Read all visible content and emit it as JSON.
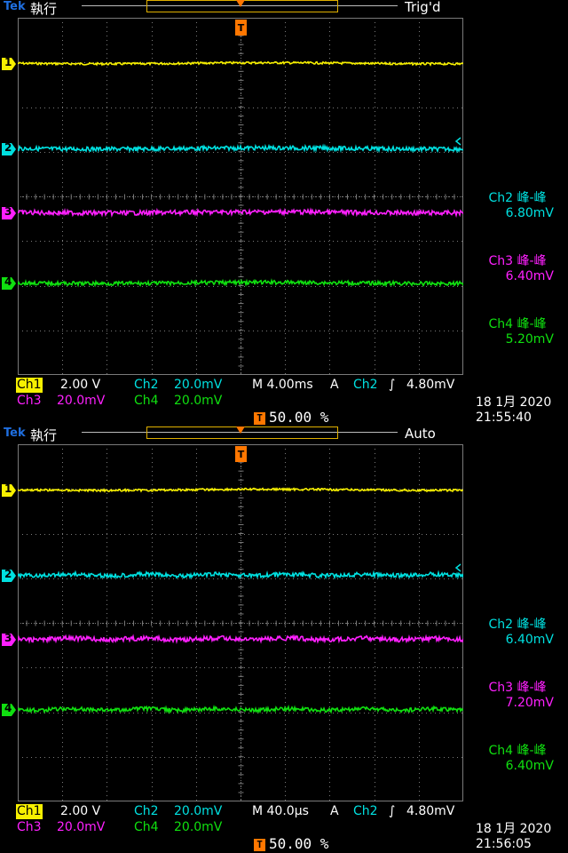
{
  "colors": {
    "ch1": "#f7f000",
    "ch2": "#00e0e0",
    "ch3": "#ff20ff",
    "ch4": "#10e010",
    "grid": "#7a7a7a",
    "trigger": "#ff7700",
    "brand": "#1f6fe0"
  },
  "icons": {
    "trigger_position": "trigger-position-icon",
    "ch2_trigger_level": "trigger-level-arrow-icon",
    "rising_edge": "rising-edge-icon",
    "coupling": "bandwidth-limit-icon"
  },
  "screens": [
    {
      "brand": "Tek",
      "mode": "執行",
      "trig_state": "Trig'd",
      "channels": [
        {
          "id": "1",
          "scale": "2.00 V",
          "level": 0.1275
        },
        {
          "id": "2",
          "scale": "20.0mV",
          "level": 0.366
        },
        {
          "id": "3",
          "scale": "20.0mV",
          "level": 0.545
        },
        {
          "id": "4",
          "scale": "20.0mV",
          "level": 0.7425
        }
      ],
      "measurements": [
        {
          "label": "Ch2 峰-峰",
          "value": "6.80mV"
        },
        {
          "label": "Ch3 峰-峰",
          "value": "6.40mV"
        },
        {
          "label": "Ch4 峰-峰",
          "value": "5.20mV"
        }
      ],
      "ch1_label": "Ch1",
      "ch1_scale": "2.00 V",
      "ch2_label": "Ch2",
      "ch2_scale": "20.0mV",
      "ch3_label": "Ch3",
      "ch3_scale": "20.0mV",
      "ch4_label": "Ch4",
      "ch4_scale": "20.0mV",
      "timebase": "M 4.00ms",
      "trig_mode": "A",
      "trig_source": "Ch2",
      "trig_slope": "∫",
      "trig_level": "4.80mV",
      "trig_position": "50.00 %",
      "date": "18 1月  2020",
      "time": "21:55:40"
    },
    {
      "brand": "Tek",
      "mode": "執行",
      "trig_state": "Auto",
      "channels": [
        {
          "id": "1",
          "scale": "2.00 V",
          "level": 0.1275
        },
        {
          "id": "2",
          "scale": "20.0mV",
          "level": 0.366
        },
        {
          "id": "3",
          "scale": "20.0mV",
          "level": 0.545
        },
        {
          "id": "4",
          "scale": "20.0mV",
          "level": 0.7425
        }
      ],
      "measurements": [
        {
          "label": "Ch2 峰-峰",
          "value": "6.40mV"
        },
        {
          "label": "Ch3 峰-峰",
          "value": "7.20mV"
        },
        {
          "label": "Ch4 峰-峰",
          "value": "6.40mV"
        }
      ],
      "ch1_label": "Ch1",
      "ch1_scale": "2.00 V",
      "ch2_label": "Ch2",
      "ch2_scale": "20.0mV",
      "ch3_label": "Ch3",
      "ch3_scale": "20.0mV",
      "ch4_label": "Ch4",
      "ch4_scale": "20.0mV",
      "timebase": "M 40.0µs",
      "trig_mode": "A",
      "trig_source": "Ch2",
      "trig_slope": "∫",
      "trig_level": "4.80mV",
      "trig_position": "50.00 %",
      "date": "18 1月  2020",
      "time": "21:56:05"
    }
  ]
}
